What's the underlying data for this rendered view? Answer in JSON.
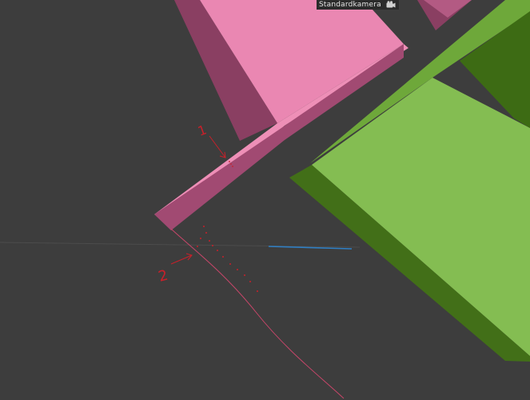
{
  "viewport": {
    "camera_label": "Standardkamera",
    "camera_icon": "camera-icon",
    "background_color": "#3d3d3d"
  },
  "annotations": {
    "label_1": "1",
    "label_2": "2",
    "annotation_color": "#c8202a"
  },
  "objects": {
    "pink_color": "#e985b0",
    "pink_dark_color": "#8a3f62",
    "green_color": "#82ba50",
    "green_dark_color": "#3d6b14",
    "axis_color": "#2f7fc4"
  }
}
